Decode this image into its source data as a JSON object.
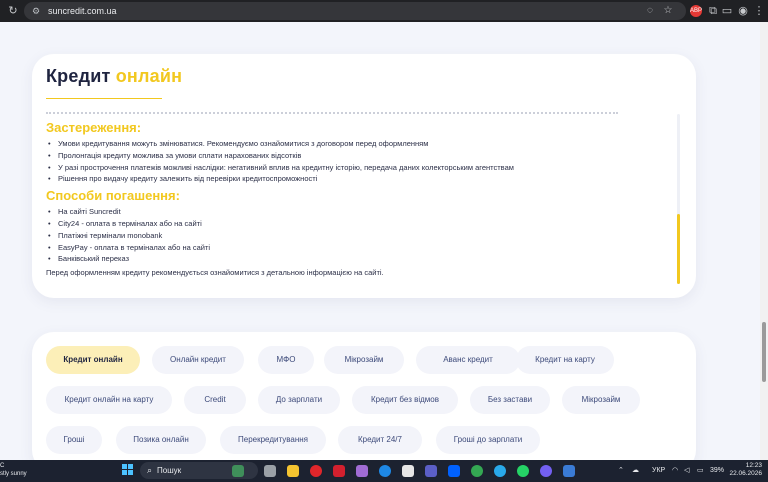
{
  "browser": {
    "url": "suncredit.com.ua",
    "profile_badge": "ABP"
  },
  "card": {
    "title_main": "Кредит",
    "title_accent": "онлайн",
    "warnings_heading": "Застереження:",
    "warnings": [
      "Умови кредитування можуть змінюватися. Рекомендуємо ознайомитися з договором перед оформленням",
      "Пролонгація кредиту можлива за умови сплати нарахованих відсотків",
      "У разі прострочення платежів можливі наслідки: негативний вплив на кредитну історію, передача даних колекторським агентствам",
      "Рішення про видачу кредиту залежить від перевірки кредитоспроможності"
    ],
    "payment_heading": "Способи погашення:",
    "payment_methods": [
      "На сайті Suncredit",
      "City24 - оплата в терміналах або на сайті",
      "Платіжні термінали monobank",
      "EasyPay - оплата в терміналах або на сайті",
      "Банківський переказ"
    ],
    "note": "Перед оформленням кредиту рекомендується ознайомитися з детальною інформацією на сайті."
  },
  "tags": [
    "Кредит онлайн",
    "Онлайн кредит",
    "МФО",
    "Мікрозайм",
    "Аванс кредит",
    "Кредит на карту",
    "Кредит онлайн на карту",
    "Credit",
    "До зарплати",
    "Кредит без відмов",
    "Без застави",
    "Мікрозайм",
    "Гроші",
    "Позика онлайн",
    "Перекредитування",
    "Кредит 24/7",
    "Гроші до зарплати"
  ],
  "taskbar": {
    "weather_line1": "C",
    "weather_line2": "stly sunny",
    "search_label": "Пошук",
    "language": "УКР",
    "battery": "39%",
    "time": "12:23",
    "date": "22.06.2026"
  },
  "colors": {
    "accent": "#f2c81f",
    "navy": "#1f2440",
    "active_tag": "#fcefb8"
  }
}
